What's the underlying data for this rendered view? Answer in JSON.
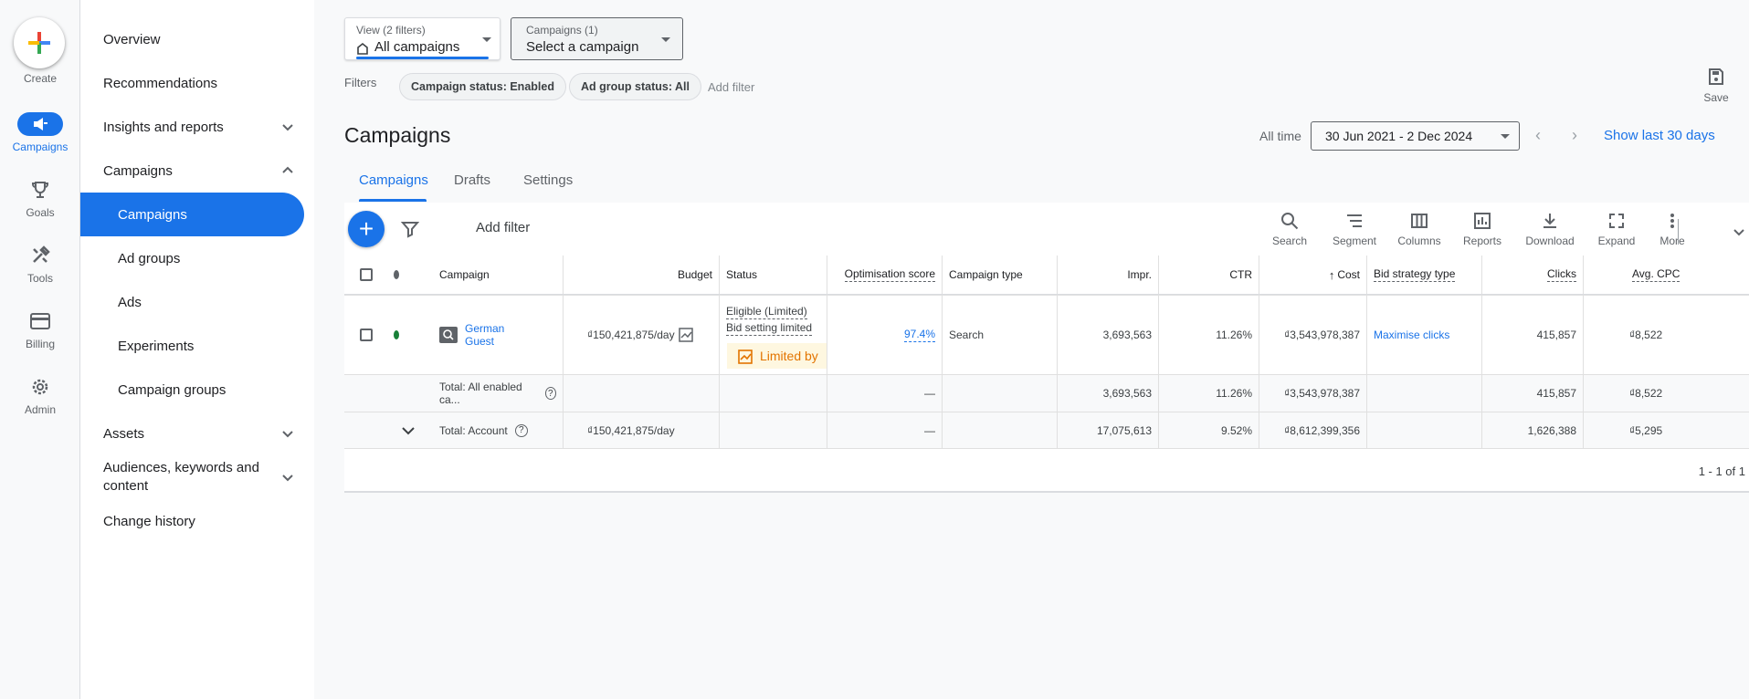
{
  "rail": {
    "create_label": "Create",
    "items": [
      {
        "label": "Campaigns",
        "icon": "megaphone-icon"
      },
      {
        "label": "Goals",
        "icon": "trophy-icon"
      },
      {
        "label": "Tools",
        "icon": "tools-icon"
      },
      {
        "label": "Billing",
        "icon": "credit-card-icon"
      },
      {
        "label": "Admin",
        "icon": "gear-icon"
      }
    ]
  },
  "sidenav": {
    "items": [
      {
        "label": "Overview"
      },
      {
        "label": "Recommendations"
      },
      {
        "label": "Insights and reports"
      },
      {
        "label": "Campaigns"
      },
      {
        "label": "Campaigns"
      },
      {
        "label": "Ad groups"
      },
      {
        "label": "Ads"
      },
      {
        "label": "Experiments"
      },
      {
        "label": "Campaign groups"
      },
      {
        "label": "Assets"
      },
      {
        "label": "Audiences, keywords and content"
      },
      {
        "label": "Change history"
      }
    ]
  },
  "header": {
    "view_small": "View (2 filters)",
    "view_big": "All campaigns",
    "campaigns_small": "Campaigns (1)",
    "campaigns_big": "Select a campaign",
    "filters_label": "Filters",
    "chips": [
      "Campaign status: Enabled",
      "Ad group status: All"
    ],
    "add_filter": "Add filter",
    "save_label": "Save"
  },
  "page": {
    "title": "Campaigns",
    "all_time": "All time",
    "date_range": "30 Jun 2021 - 2 Dec 2024",
    "show_last": "Show last 30 days",
    "tabs": [
      "Campaigns",
      "Drafts",
      "Settings"
    ]
  },
  "toolbar": {
    "add_filter": "Add filter",
    "tools": [
      "Search",
      "Segment",
      "Columns",
      "Reports",
      "Download",
      "Expand",
      "More"
    ]
  },
  "table": {
    "columns": [
      "Campaign",
      "Budget",
      "Status",
      "Optimisation score",
      "Campaign type",
      "Impr.",
      "CTR",
      "Cost",
      "Bid strategy type",
      "Clicks",
      "Avg. CPC"
    ],
    "row": {
      "campaign_line1": "German",
      "campaign_line2": "Guest",
      "budget": "₫150,421,875/day",
      "status_line1": "Eligible (Limited)",
      "status_line2": "Bid setting limited",
      "limited_by": "Limited by",
      "opt_score": "97.4%",
      "campaign_type": "Search",
      "impr": "3,693,563",
      "ctr": "11.26%",
      "cost": "₫3,543,978,387",
      "bid_strategy": "Maximise clicks",
      "clicks": "415,857",
      "avg_cpc": "₫8,522",
      "status_color": "#188038"
    },
    "total_enabled": {
      "label": "Total: All enabled ca...",
      "opt_score": "—",
      "impr": "3,693,563",
      "ctr": "11.26%",
      "cost": "₫3,543,978,387",
      "clicks": "415,857",
      "avg_cpc": "₫8,522"
    },
    "total_account": {
      "label": "Total: Account",
      "budget": "₫150,421,875/day",
      "opt_score": "—",
      "impr": "17,075,613",
      "ctr": "9.52%",
      "cost": "₫8,612,399,356",
      "clicks": "1,626,388",
      "avg_cpc": "₫5,295"
    },
    "pager": "1 - 1 of 1"
  },
  "colors": {
    "accent": "#1a73e8",
    "warning_text": "#e37400",
    "warning_bg": "#fef7e0"
  }
}
